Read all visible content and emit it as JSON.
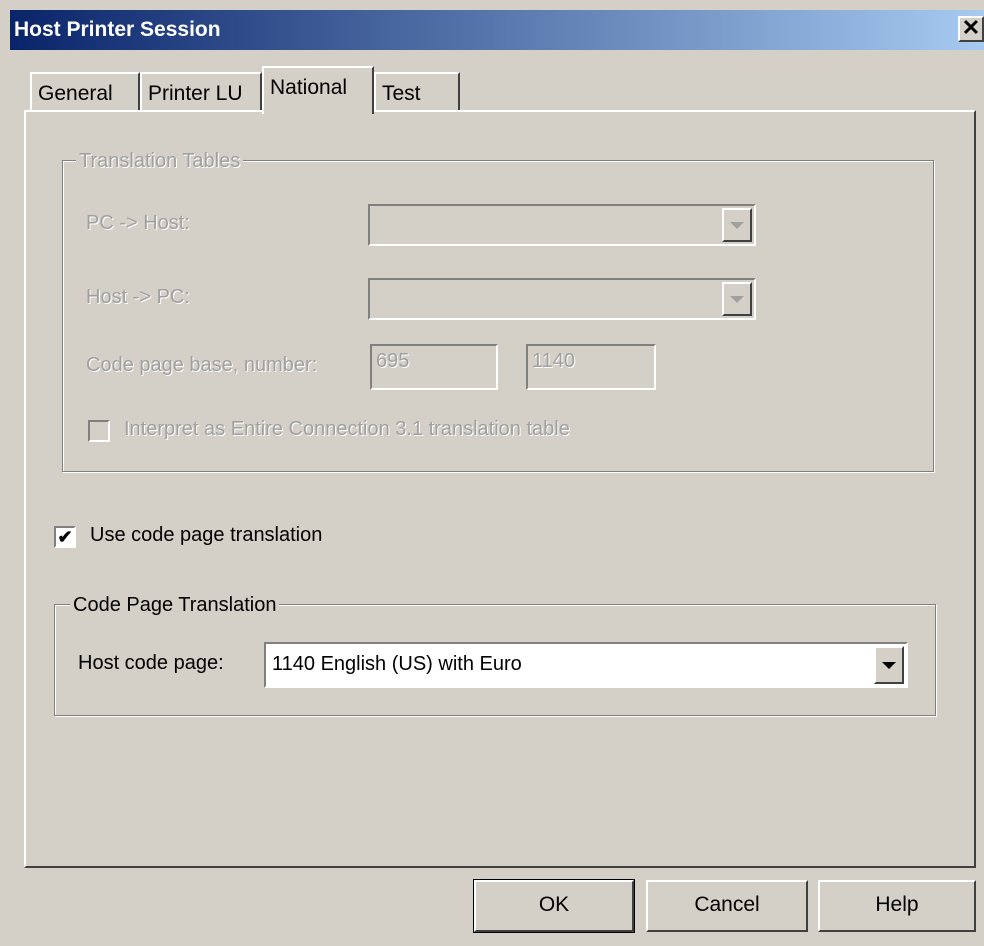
{
  "window": {
    "title": "Host Printer Session",
    "close_glyph": "✕"
  },
  "tabs": [
    {
      "label": "General"
    },
    {
      "label": "Printer LU"
    },
    {
      "label": "National",
      "active": true
    },
    {
      "label": "Test"
    }
  ],
  "translation_tables": {
    "title": "Translation Tables",
    "pc_to_host_label": "PC -> Host:",
    "pc_to_host_value": "",
    "host_to_pc_label": "Host -> PC:",
    "host_to_pc_value": "",
    "code_page_label": "Code page base, number:",
    "code_page_base": "695",
    "code_page_number": "1140",
    "interpret_label": "Interpret as Entire Connection 3.1 translation table",
    "interpret_checked": false
  },
  "use_code_page": {
    "label": "Use code page translation",
    "checked": true,
    "check_glyph": "✔"
  },
  "code_page_translation": {
    "title": "Code Page Translation",
    "host_code_page_label": "Host code page:",
    "host_code_page_value": "1140 English (US) with Euro"
  },
  "buttons": {
    "ok": "OK",
    "cancel": "Cancel",
    "help": "Help"
  }
}
